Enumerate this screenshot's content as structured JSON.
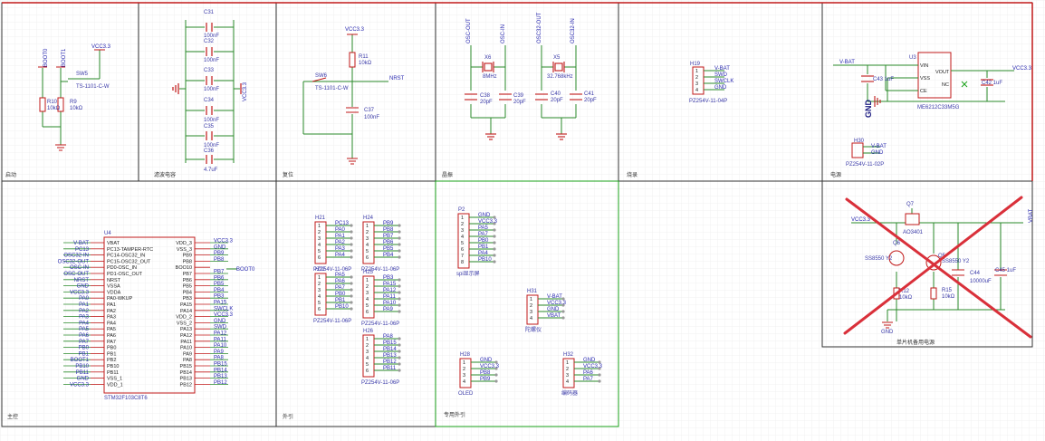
{
  "sections": {
    "boot": "启动",
    "filter": "滤波电容",
    "reset": "复位",
    "crystal": "晶振",
    "download": "烧录",
    "power": "电源",
    "mcu": "主控",
    "ext": "外引",
    "dedicated": "专用外引",
    "backup": "单片机备用电源"
  },
  "boot": {
    "boot0": "BOOT0",
    "boot1": "BOOT1",
    "vcc": "VCC3.3",
    "sw": "SW5",
    "sw_part": "TS-1101-C-W",
    "r10": "R10",
    "r10v": "10kΩ",
    "r9": "R9",
    "r9v": "10kΩ"
  },
  "filter": {
    "caps": [
      "C31",
      "C32",
      "C33",
      "C34",
      "C35",
      "C36"
    ],
    "vals": [
      "100nF",
      "100nF",
      "100nF",
      "100nF",
      "100nF",
      "4.7uF"
    ],
    "vcc": "VCC3.3"
  },
  "reset": {
    "vcc": "VCC3.3",
    "r11": "R11",
    "r11v": "10kΩ",
    "sw": "SW6",
    "sw_part": "TS-1101-C-W",
    "nrst": "NRST",
    "c37": "C37",
    "c37v": "100nF"
  },
  "crystal": {
    "n1": "OSC-OUT",
    "n2": "OSC-IN",
    "n3": "OSC32-OUT",
    "n4": "OSC32-IN",
    "x6": "X6",
    "x6v": "8MHz",
    "x5": "X5",
    "x5v": "32.768kHz",
    "c38": "C38",
    "c38v": "20pF",
    "c39": "C39",
    "c39v": "20pF",
    "c40": "C40",
    "c40v": "20pF",
    "c41": "C41",
    "c41v": "20pF"
  },
  "download": {
    "ref": "H19",
    "part": "PZ254V-11-04P",
    "pins": [
      "V-BAT",
      "SWD",
      "SWCLK",
      "GND"
    ]
  },
  "power": {
    "vbat": "V-BAT",
    "u3": "U3",
    "vcc": "VCC3.3",
    "pins_l": [
      "VIN",
      "VSS",
      "CE"
    ],
    "pins_r": [
      "VOUT",
      "NC"
    ],
    "c43": "C43 1uF",
    "c42": "C42 1uF",
    "gnd": "GND",
    "part": "ME6212C33M5G",
    "h30": "H30",
    "h30pins": [
      "V-BAT",
      "GND"
    ],
    "h30part": "PZ254V-11-02P"
  },
  "mcu": {
    "ref": "U4",
    "part": "STM32F103C8T6",
    "left_pins": [
      "VBAT",
      "PC13-TAMPER-RTC",
      "PC14-OSC32_IN",
      "PC15-OSC32_OUT",
      "PD0-OSC_IN",
      "PD1-OSC_OUT",
      "NRST",
      "VSSA",
      "VDDA",
      "PA0-WKUP",
      "PA1",
      "PA2",
      "PA3",
      "PA4",
      "PA5",
      "PA6",
      "PA7",
      "PB0",
      "PB1",
      "PB2",
      "PB10",
      "PB11",
      "VSS_1",
      "VDD_1"
    ],
    "left_nets": [
      "V-BAT",
      "PC13",
      "OSC32-IN",
      "OSC32-OUT",
      "OSC-IN",
      "OSC-OUT",
      "NRST",
      "GND",
      "VCC3.3",
      "PA0",
      "PA1",
      "PA2",
      "PA3",
      "PA4",
      "PA5",
      "PA6",
      "PA7",
      "PB0",
      "PB1",
      "BOOT1",
      "PB10",
      "PB11",
      "GND",
      "VCC3.3"
    ],
    "right_pins": [
      "VDD_3",
      "VSS_3",
      "PB9",
      "PB8",
      "BOO10",
      "PB7",
      "PB6",
      "PB5",
      "PB4",
      "PB3",
      "PA15",
      "PA14",
      "VDD_2",
      "VSS_2",
      "PA13",
      "PA12",
      "PA11",
      "PA10",
      "PA9",
      "PA8",
      "PB15",
      "PB14",
      "PB13",
      "PB12"
    ],
    "right_nets": [
      "VCC3.3",
      "GND",
      "PB9",
      "PB8",
      "",
      "PB7",
      "PB6",
      "PB5",
      "PB4",
      "PB3",
      "PA15",
      "SWCLK",
      "VCC3.3",
      "GND",
      "SWD",
      "PA12",
      "PA11",
      "PA10",
      "PA9",
      "PA8",
      "PB15",
      "PB14",
      "PB13",
      "PB12"
    ],
    "boot0_net": "BOOT0"
  },
  "ext": {
    "h21": {
      "ref": "H21",
      "part": "PZ254V-11-06P",
      "nets": [
        "PC13",
        "PA0",
        "PA1",
        "PA2",
        "PA3",
        "PA4"
      ]
    },
    "h24": {
      "ref": "H24",
      "part": "PZ254V-11-06P",
      "nets": [
        "PB9",
        "PB8",
        "PB7",
        "PB6",
        "PB5",
        "PB4"
      ]
    },
    "h22": {
      "ref": "H22",
      "part": "PZ254V-11-06P",
      "nets": [
        "PA5",
        "PA6",
        "PA7",
        "PB0",
        "PB1",
        "PB10"
      ]
    },
    "h25": {
      "ref": "H25",
      "part": "PZ254V-11-06P",
      "nets": [
        "PB3",
        "PA15",
        "PA12",
        "PA11",
        "PA10",
        "PA9"
      ]
    },
    "h26": {
      "ref": "H26",
      "part": "PZ254V-11-06P",
      "nets": [
        "PA8",
        "PB15",
        "PB14",
        "PB13",
        "PB12",
        "PB11"
      ]
    }
  },
  "ded": {
    "p2": {
      "ref": "P2",
      "part": "spi显示屏",
      "nets": [
        "GND",
        "VCC3.3",
        "PA5",
        "PA7",
        "PB0",
        "PB1",
        "PA4",
        "PB10"
      ]
    },
    "h31": {
      "ref": "H31",
      "part": "陀螺仪",
      "nets": [
        "V-BAT",
        "VCC3.3",
        "GND",
        "VBAT"
      ]
    },
    "h28": {
      "ref": "H28",
      "part": "OLED",
      "nets": [
        "GND",
        "VCC3.3",
        "PB8",
        "PB9"
      ]
    },
    "h32": {
      "ref": "H32",
      "part": "编码器",
      "nets": [
        "GND",
        "VCC3.3",
        "PA6",
        "PA7"
      ]
    }
  },
  "backup": {
    "q7": "Q7",
    "q7part": "AO3401",
    "vcc": "VCC3.3",
    "vbat": "VBAT",
    "q6": "Q6",
    "q6part": "SS8550 Y2",
    "q5": "Q5",
    "q5part": "SS8550 Y2",
    "c44": "C44",
    "c44v": "10000uF",
    "c45": "C45 1uF",
    "r12": "R12",
    "r12v": "10kΩ",
    "r15": "R15",
    "r15v": "10kΩ",
    "gnd": "GND"
  }
}
